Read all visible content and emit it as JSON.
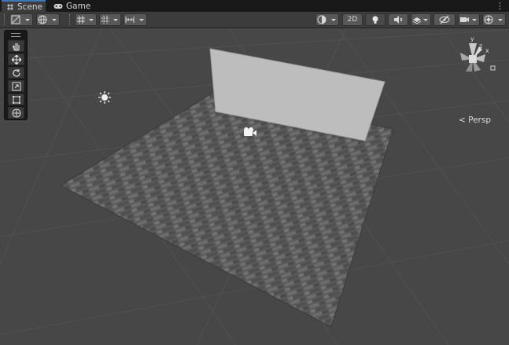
{
  "tabs": [
    {
      "label": "Scene",
      "active": true
    },
    {
      "label": "Game",
      "active": false
    }
  ],
  "toolbar": {
    "mode_2d_label": "2D"
  },
  "viewport": {
    "projection_label": "< Persp",
    "gizmo_axes": {
      "y": "y",
      "x": "x",
      "z": "z"
    }
  },
  "colors": {
    "tab_accent": "#3a79bb",
    "scene_background": "#474747",
    "floor": "#5a5a5a",
    "wall": "#bdbdbd"
  }
}
